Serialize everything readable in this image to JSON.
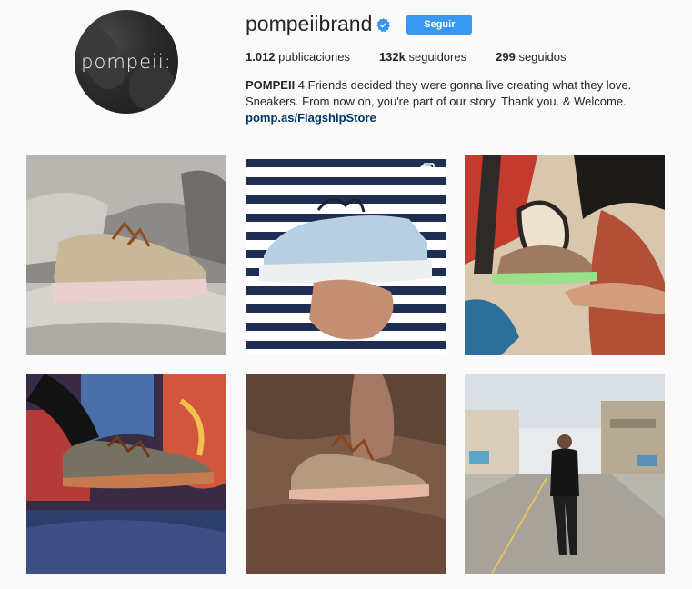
{
  "profile": {
    "avatar_text": "pompeii:",
    "username": "pompeiibrand",
    "follow_label": "Seguir"
  },
  "stats": {
    "posts_count": "1.012",
    "posts_label": "publicaciones",
    "followers_count": "132k",
    "followers_label": "seguidores",
    "following_count": "299",
    "following_label": "seguidos"
  },
  "bio": {
    "name": "POMPEII",
    "line1": " 4 Friends decided they were gonna live creating what they love.",
    "line2": "Sneakers. From now on, you're part of our story. Thank you. & Welcome.",
    "link": "pomp.as/FlagshipStore"
  },
  "colors": {
    "accent": "#3897f0",
    "link": "#003569",
    "background": "#fafafa"
  },
  "icons": [
    "verified-badge-icon",
    "multiple-photos-icon"
  ]
}
